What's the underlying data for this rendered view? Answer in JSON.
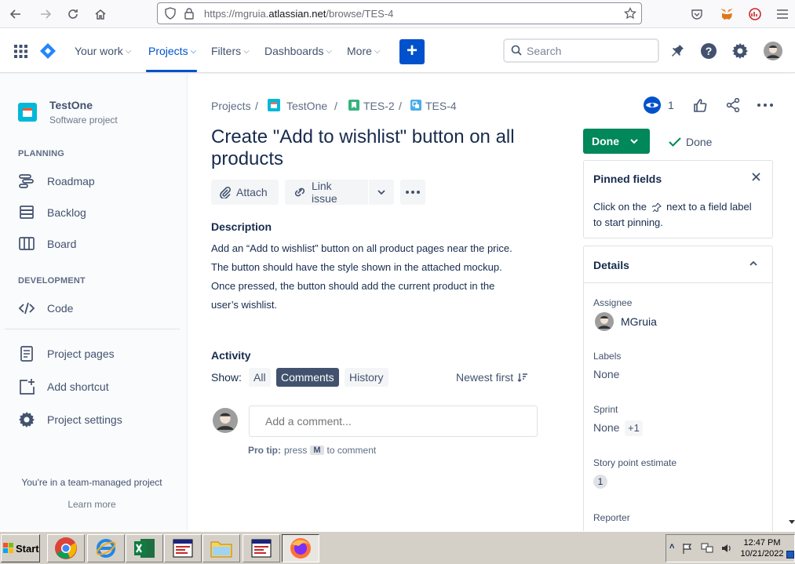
{
  "browser": {
    "url_prefix": "https://mgruia.",
    "url_domain": "atlassian.net",
    "url_path": "/browse/TES-4"
  },
  "nav": {
    "your_work": "Your work",
    "projects": "Projects",
    "filters": "Filters",
    "dashboards": "Dashboards",
    "more": "More",
    "create": "+",
    "search_placeholder": "Search"
  },
  "sidebar": {
    "project_name": "TestOne",
    "project_type": "Software project",
    "planning_heading": "PLANNING",
    "development_heading": "DEVELOPMENT",
    "items": [
      {
        "label": "Roadmap"
      },
      {
        "label": "Backlog"
      },
      {
        "label": "Board"
      },
      {
        "label": "Code"
      },
      {
        "label": "Project pages"
      },
      {
        "label": "Add shortcut"
      },
      {
        "label": "Project settings"
      }
    ],
    "footer_text": "You're in a team-managed project",
    "learn_more": "Learn more"
  },
  "breadcrumb": {
    "projects": "Projects",
    "project": "TestOne",
    "parent": "TES-2",
    "issue": "TES-4",
    "separator": "/"
  },
  "issue": {
    "title": "Create \"Add to wishlist\" button on all products",
    "attach": "Attach",
    "link_issue": "Link issue",
    "description_heading": "Description",
    "description": "Add an “Add to wishlist” button on all product pages near the price. The button should have the style shown in the attached mockup. Once pressed, the button should add the current product in the user’s wishlist."
  },
  "activity": {
    "heading": "Activity",
    "show_label": "Show:",
    "filters": [
      "All",
      "Comments",
      "History"
    ],
    "active_filter": "Comments",
    "sort": "Newest first",
    "comment_placeholder": "Add a comment...",
    "pro_tip_label": "Pro tip:",
    "pro_tip_press": "press",
    "pro_tip_key": "M",
    "pro_tip_rest": "to comment"
  },
  "header_actions": {
    "watchers": "1"
  },
  "status": {
    "button": "Done",
    "resolution": "Done"
  },
  "pinned": {
    "title": "Pinned fields",
    "text_before": "Click on the",
    "text_after": "next to a field label to start pinning."
  },
  "details": {
    "title": "Details",
    "assignee_label": "Assignee",
    "assignee": "MGruia",
    "labels_label": "Labels",
    "labels": "None",
    "sprint_label": "Sprint",
    "sprint": "None",
    "sprint_extra": "+1",
    "story_points_label": "Story point estimate",
    "story_points": "1",
    "reporter_label": "Reporter"
  },
  "taskbar": {
    "start": "Start",
    "time": "12:47 PM",
    "date": "10/21/2022"
  },
  "colors": {
    "brand_blue": "#0052cc",
    "done_green": "#00875a",
    "sidebar_bg": "#fafbfc"
  }
}
